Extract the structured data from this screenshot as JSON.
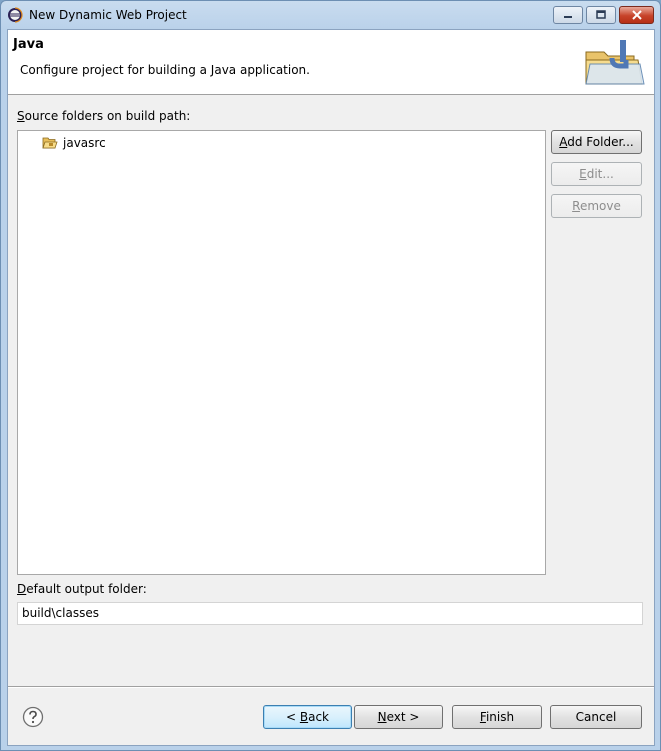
{
  "window": {
    "title": "New Dynamic Web Project"
  },
  "header": {
    "title": "Java",
    "description": "Configure project for building a Java application."
  },
  "source_folders": {
    "label_underlined": "S",
    "label_rest": "ource folders on build path:",
    "items": [
      {
        "label": "javasrc",
        "icon": "package-folder-icon"
      }
    ]
  },
  "side_buttons": {
    "add_folder_u": "A",
    "add_folder_rest": "dd Folder...",
    "edit_u": "E",
    "edit_rest": "dit...",
    "remove_u": "R",
    "remove_rest": "emove"
  },
  "output": {
    "label_underlined": "D",
    "label_rest": "efault output folder:",
    "value": "build\\classes"
  },
  "footer": {
    "back_prefix": "< ",
    "back_u": "B",
    "back_rest": "ack",
    "next_u": "N",
    "next_rest": "ext >",
    "finish_u": "F",
    "finish_rest": "inish",
    "cancel": "Cancel"
  },
  "colors": {
    "titlebar": "#b9d1ea",
    "dialog_bg": "#f0f0f0",
    "close_button": "#c7432a",
    "default_button_border": "#3c7fb1"
  },
  "icons": [
    "eclipse-app-icon",
    "minimize-icon",
    "maximize-icon",
    "close-icon",
    "java-folder-wizard-icon",
    "package-folder-icon",
    "help-icon"
  ]
}
